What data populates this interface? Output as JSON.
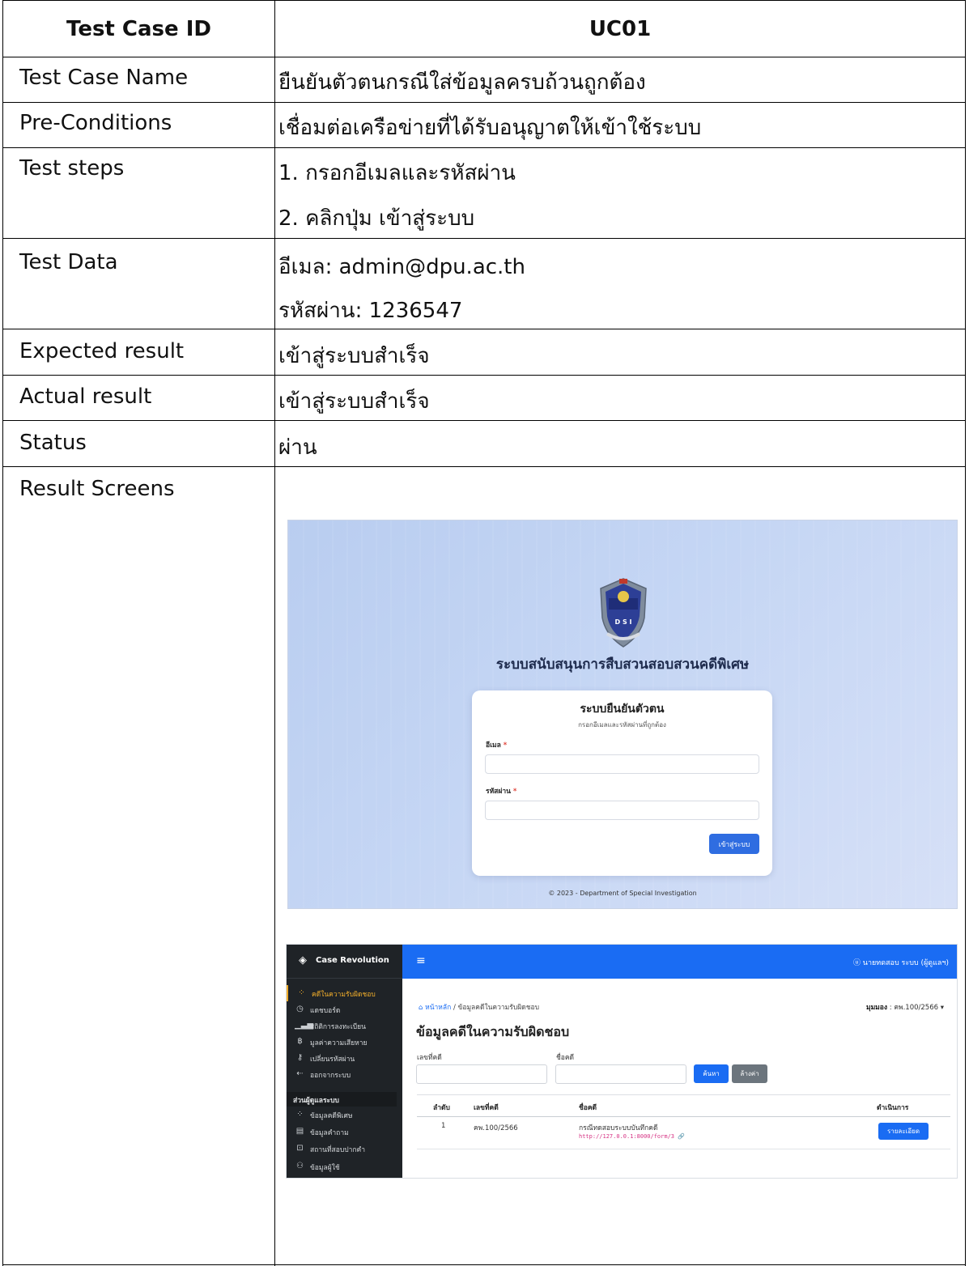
{
  "test_case": {
    "header": {
      "label": "Test Case ID",
      "value": "UC01"
    },
    "rows": [
      {
        "label": "Test Case Name",
        "value": "ยืนยันตัวตนกรณีใส่ข้อมูลครบถ้วนถูกต้อง"
      },
      {
        "label": "Pre-Conditions",
        "value": "เชื่อมต่อเครือข่ายที่ได้รับอนุญาตให้เข้าใช้ระบบ"
      },
      {
        "label": "Test steps",
        "value": "1. กรอกอีเมลและรหัสผ่าน",
        "value2": "2. คลิกปุ่ม เข้าสู่ระบบ"
      },
      {
        "label": "Test Data",
        "value": "อีเมล: admin@dpu.ac.th",
        "value2": "รหัสผ่าน: 1236547"
      },
      {
        "label": "Expected result",
        "value": "เข้าสู่ระบบสำเร็จ"
      },
      {
        "label": "Actual result",
        "value": "เข้าสู่ระบบสำเร็จ"
      },
      {
        "label": "Status",
        "value": "ผ่าน"
      },
      {
        "label": "Result Screens"
      }
    ]
  },
  "login_screen": {
    "logo_text": "D S I",
    "title": "ระบบสนับสนุนการสืบสวนสอบสวนคดีพิเศษ",
    "card": {
      "title": "ระบบยืนยันตัวตน",
      "subtitle": "กรอกอีเมลและรหัสผ่านที่ถูกต้อง",
      "email_label": "อีเมล",
      "password_label": "รหัสผ่าน",
      "required_mark": "*",
      "submit_label": "เข้าสู่ระบบ"
    },
    "footer": "© 2023 - Department of Special Investigation",
    "colors": {
      "primary": "#2f6de1",
      "background": "#c5d6f4"
    }
  },
  "dashboard_screen": {
    "brand": "Case Revolution",
    "brand_icon": "layers-icon",
    "sidebar": {
      "items": [
        {
          "icon": "grid-icon",
          "label": "คดีในความรับผิดชอบ",
          "active": true
        },
        {
          "icon": "dashboard-icon",
          "label": "แดชบอร์ด"
        },
        {
          "icon": "bar-chart-icon",
          "label": "สถิติการลงทะเบียน"
        },
        {
          "icon": "money-icon",
          "label": "มูลค่าความเสียหาย"
        },
        {
          "icon": "key-icon",
          "label": "เปลี่ยนรหัสผ่าน"
        },
        {
          "icon": "logout-icon",
          "label": "ออกจากระบบ"
        }
      ],
      "section_title": "ส่วนผู้ดูแลระบบ",
      "admin_items": [
        {
          "icon": "grid-icon",
          "label": "ข้อมูลคดีพิเศษ"
        },
        {
          "icon": "chat-icon",
          "label": "ข้อมูลคำถาม"
        },
        {
          "icon": "bookmark-icon",
          "label": "สถานที่สอบปากคำ"
        },
        {
          "icon": "user-icon",
          "label": "ข้อมูลผู้ใช้"
        }
      ]
    },
    "topbar": {
      "menu_icon": "hamburger-icon",
      "user": "ⓤ นายทดสอบ ระบบ (ผู้ดูแลฯ)"
    },
    "breadcrumb": {
      "home": "⌂ หน้าหลัก",
      "separator": "/",
      "current": "ข้อมูลคดีในความรับผิดชอบ"
    },
    "period": {
      "label": "มุมมอง",
      "value": ": คพ.100/2566 ▾"
    },
    "page_title": "ข้อมูลคดีในความรับผิดชอบ",
    "filters": {
      "case_no_label": "เลขที่คดี",
      "case_name_label": "ชื่อคดี",
      "search_label": "ค้นหา",
      "clear_label": "ล้างค่า"
    },
    "table": {
      "headers": [
        "ลำดับ",
        "เลขที่คดี",
        "ชื่อคดี",
        "ดำเนินการ"
      ],
      "rows": [
        {
          "no": "1",
          "case_no": "คพ.100/2566",
          "name": "กรณีทดสอบระบบบันทึกคดี",
          "link": "http://127.0.0.1:8000/form/3 🔗",
          "action": "รายละเอียด"
        }
      ]
    },
    "colors": {
      "primary": "#1a6cf3",
      "sidebar": "#1f2327",
      "active": "#f0ad2b"
    }
  }
}
